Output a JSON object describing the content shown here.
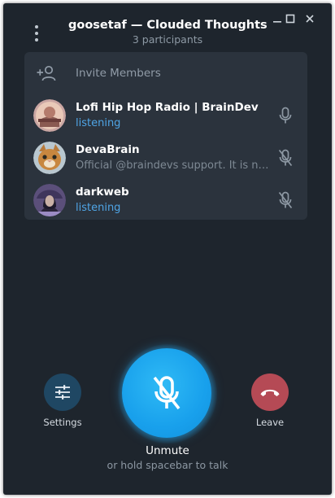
{
  "header": {
    "title": "goosetaf — Clouded Thoughts",
    "subtitle": "3 participants",
    "menu_icon": "more-vertical-icon",
    "window_controls": [
      "minimize-icon",
      "maximize-icon",
      "close-icon"
    ]
  },
  "invite": {
    "label": "Invite Members",
    "icon": "add-user-icon"
  },
  "participants": [
    {
      "name": "Lofi Hip Hop Radio | BrainDev",
      "status": "listening",
      "status_color": "#4fa5e6",
      "mic": "mic-icon"
    },
    {
      "name": "DevaBrain",
      "status": "Official @braindevs support. It is neve...",
      "status_color": "#7e8994",
      "mic": "mic-off-icon"
    },
    {
      "name": "darkweb",
      "status": "listening",
      "status_color": "#4fa5e6",
      "mic": "mic-off-icon"
    }
  ],
  "controls": {
    "settings_label": "Settings",
    "leave_label": "Leave",
    "unmute_label": "Unmute",
    "hint": "or hold spacebar to talk"
  },
  "colors": {
    "window_bg": "#1e252d",
    "panel_bg": "#2b333d",
    "accent_blue": "#18a0ec",
    "settings_btn": "#1f4763",
    "leave_btn": "#b54a55"
  }
}
